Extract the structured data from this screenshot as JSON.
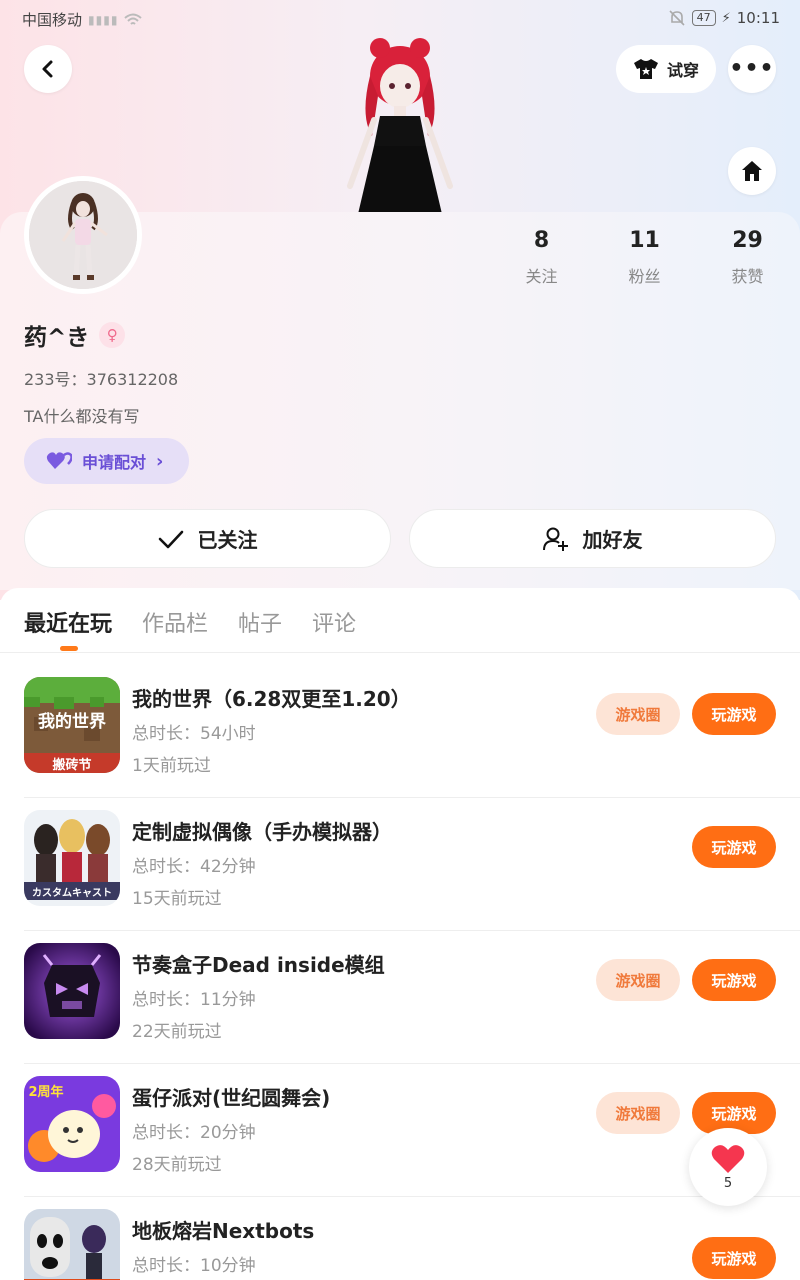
{
  "status": {
    "carrier": "中国移动",
    "battery": "47",
    "time": "10:11"
  },
  "header": {
    "tryon_label": "试穿"
  },
  "stats": [
    {
      "num": "8",
      "label": "关注"
    },
    {
      "num": "11",
      "label": "粉丝"
    },
    {
      "num": "29",
      "label": "获赞"
    }
  ],
  "profile": {
    "name": "药^き",
    "uid": "233号：376312208",
    "bio": "TA什么都没有写",
    "match_label": "申请配对"
  },
  "actions": {
    "followed_label": "已关注",
    "add_friend_label": "加好友"
  },
  "tabs": [
    "最近在玩",
    "作品栏",
    "帖子",
    "评论"
  ],
  "buttons": {
    "circle": "游戏圈",
    "play": "玩游戏"
  },
  "games": [
    {
      "title": "我的世界（6.28双更至1.20）",
      "duration": "总时长：54小时",
      "ago": "1天前玩过",
      "icon_text": "我的世界",
      "icon_sub": "搬砖节"
    },
    {
      "title": "定制虚拟偶像（手办模拟器）",
      "duration": "总时长：42分钟",
      "ago": "15天前玩过",
      "icon_text": "カスタムキャスト"
    },
    {
      "title": "节奏盒子Dead inside模组",
      "duration": "总时长：11分钟",
      "ago": "22天前玩过"
    },
    {
      "title": "蛋仔派对(世纪圆舞会)",
      "duration": "总时长：20分钟",
      "ago": "28天前玩过",
      "icon_text": "2周年"
    },
    {
      "title": "地板熔岩Nextbots",
      "duration": "总时长：10分钟",
      "ago": ""
    }
  ],
  "like": {
    "count": "5"
  },
  "colors": {
    "accent": "#ff6e14",
    "match": "#6a4fd6",
    "circle_bg": "#fde4d6"
  }
}
